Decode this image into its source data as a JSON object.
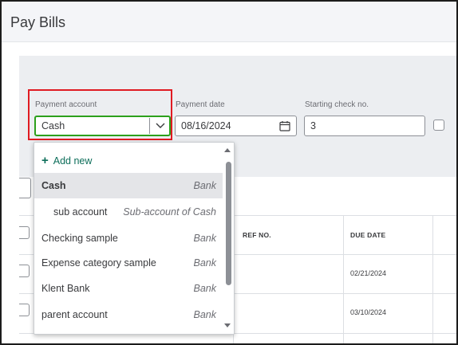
{
  "page": {
    "title": "Pay Bills"
  },
  "form": {
    "payment_account_label": "Payment account",
    "payment_account_value": "Cash",
    "payment_date_label": "Payment date",
    "payment_date_value": "08/16/2024",
    "starting_check_label": "Starting check no.",
    "starting_check_value": "3"
  },
  "table": {
    "headers": [
      "REF NO.",
      "DUE DATE"
    ],
    "rows": [
      {
        "due_date": "02/21/2024"
      },
      {
        "due_date": "03/10/2024"
      }
    ]
  },
  "dropdown": {
    "add_new": {
      "label": "Add new",
      "icon": "plus-icon"
    },
    "items": [
      {
        "name": "Cash",
        "type": "Bank",
        "selected": true
      },
      {
        "name": "sub account",
        "type": "Sub-account of Cash",
        "indent": true
      },
      {
        "name": "Checking sample",
        "type": "Bank"
      },
      {
        "name": "Expense category sample",
        "type": "Bank"
      },
      {
        "name": "Klent Bank",
        "type": "Bank"
      },
      {
        "name": "parent account",
        "type": "Bank"
      }
    ]
  },
  "colors": {
    "highlight_border": "#e01b22",
    "focus_border": "#2ca01c",
    "accent_green": "#0d6e5a",
    "selected_row": "#e4e5e8"
  }
}
